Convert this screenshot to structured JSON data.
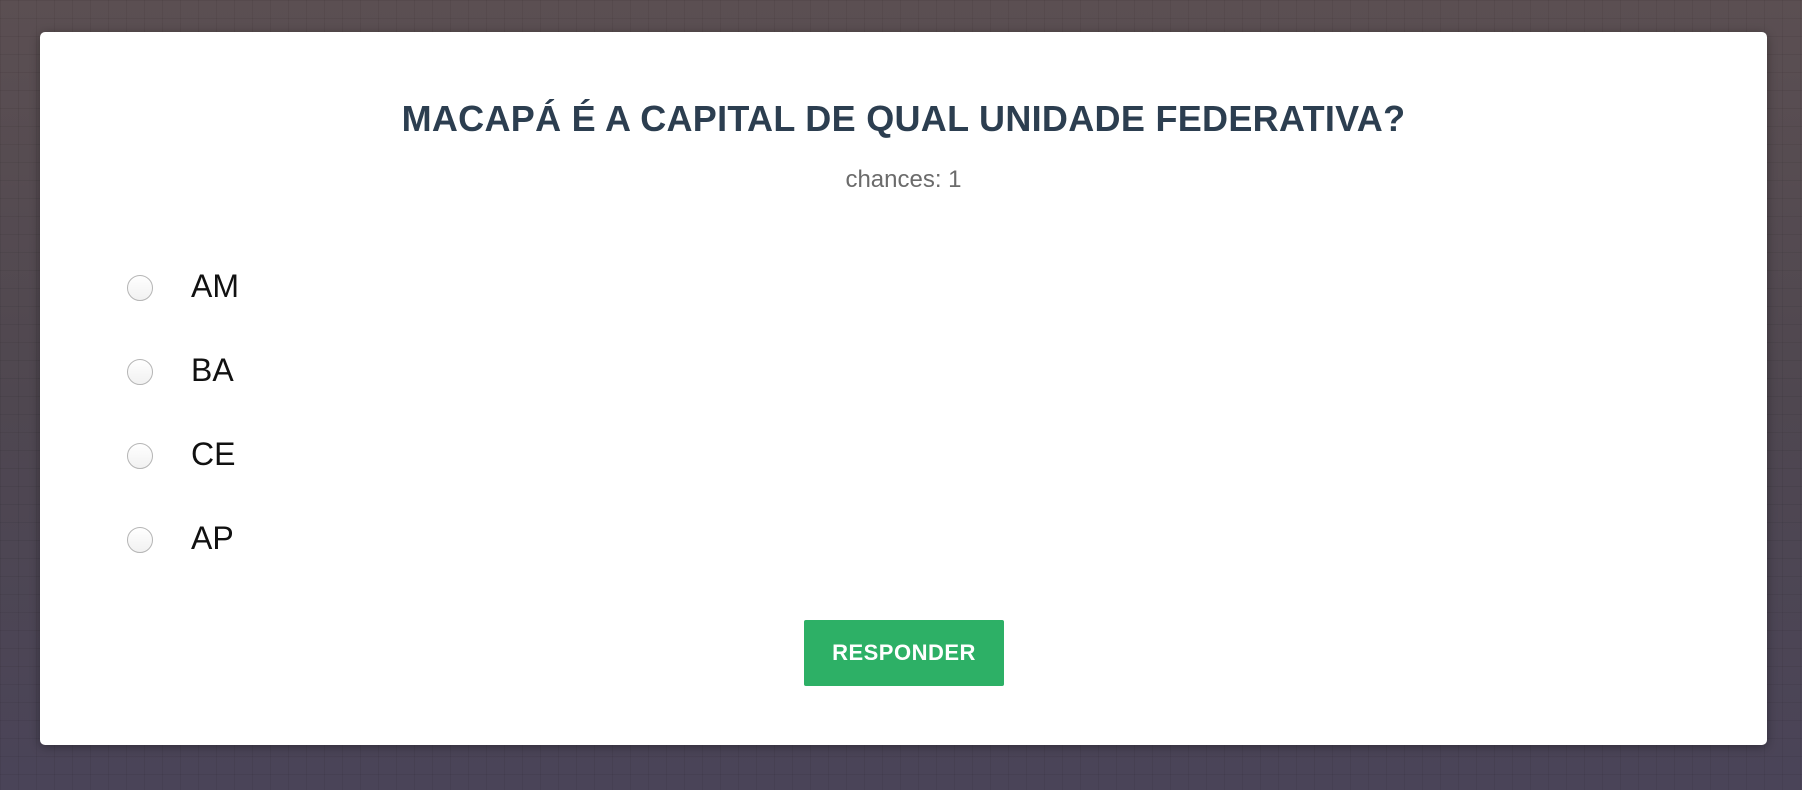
{
  "quiz": {
    "question": "MACAPÁ É A CAPITAL DE QUAL UNIDADE FEDERATIVA?",
    "chances_text": "chances: 1",
    "options": [
      {
        "label": "AM",
        "selected": false
      },
      {
        "label": "BA",
        "selected": false
      },
      {
        "label": "CE",
        "selected": false
      },
      {
        "label": "AP",
        "selected": false
      }
    ],
    "submit_label": "RESPONDER"
  },
  "colors": {
    "title": "#2c3e50",
    "button_bg": "#2db066",
    "background": "#4e4651"
  }
}
